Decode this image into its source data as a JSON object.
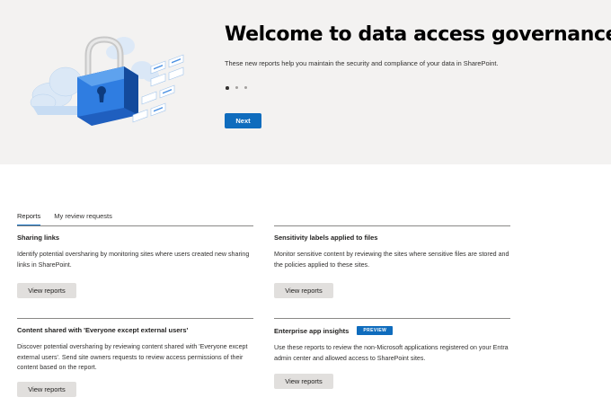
{
  "hero": {
    "title": "Welcome to data access governance",
    "subtitle": "These new reports help you maintain the security and compliance of your data in SharePoint.",
    "carousel_total": 3,
    "carousel_active": 1,
    "next_label": "Next",
    "illustration": "cloud-padlock-illustration"
  },
  "tabs": [
    {
      "label": "Reports",
      "selected": true
    },
    {
      "label": "My review requests",
      "selected": false
    }
  ],
  "cards": [
    {
      "title": "Sharing links",
      "description": "Identify potential oversharing by monitoring sites where users created new sharing links in SharePoint.",
      "button": "View reports"
    },
    {
      "title": "Sensitivity labels applied to files",
      "description": "Monitor sensitive content by reviewing the sites where sensitive files are stored and the policies applied to these sites.",
      "button": "View reports"
    },
    {
      "title": "Content shared with 'Everyone except external users'",
      "description": "Discover potential oversharing by reviewing content shared with 'Everyone except external users'. Send site owners requests to review access permissions of their content based on the report.",
      "button": "View reports"
    },
    {
      "title": "Enterprise app insights",
      "badge": "PREVIEW",
      "description": "Use these reports to review the non-Microsoft applications registered on your Entra admin center and allowed access to SharePoint sites.",
      "button": "View reports"
    }
  ],
  "colors": {
    "accent": "#0f6cbd",
    "hero_bg": "#f3f2f1",
    "secondary_button": "#e1dfdd"
  }
}
